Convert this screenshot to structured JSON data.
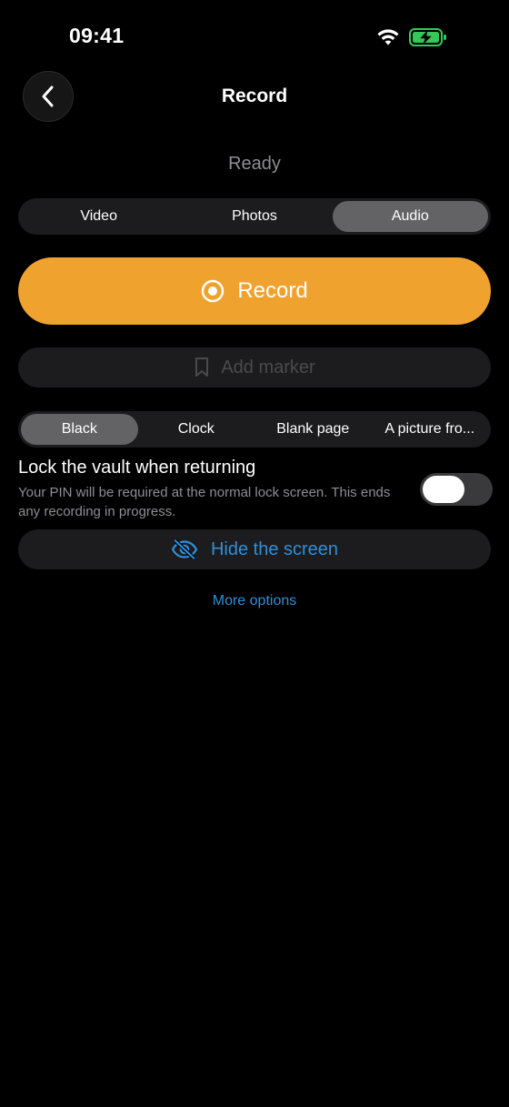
{
  "status_bar": {
    "time": "09:41",
    "icons": [
      "wifi-icon",
      "battery-charging-icon"
    ],
    "battery_color": "#34c759"
  },
  "nav": {
    "back_icon": "chevron-left-icon",
    "title": "Record"
  },
  "status": "Ready",
  "mode_tabs": {
    "items": [
      "Video",
      "Photos",
      "Audio"
    ],
    "selected": "Audio"
  },
  "record_button": {
    "label": "Record",
    "icon": "record-circle-icon",
    "color": "#f0a22e"
  },
  "marker_button": {
    "label": "Add marker",
    "icon": "bookmark-icon",
    "enabled": false
  },
  "screen_tabs": {
    "items": [
      "Black",
      "Clock",
      "Blank page",
      "A picture fro..."
    ],
    "selected": "Black"
  },
  "lock_option": {
    "title": "Lock the vault when returning",
    "description": "Your PIN will be required at the normal lock screen. This ends any recording in progress.",
    "enabled": false
  },
  "hide_button": {
    "label": "Hide the screen",
    "icon": "eye-slash-icon",
    "color": "#2f8fdb"
  },
  "more_options": "More options"
}
